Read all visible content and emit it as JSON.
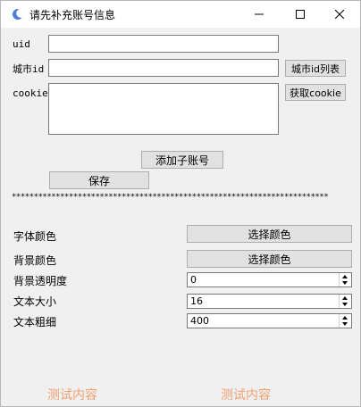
{
  "window": {
    "title": "请先补充账号信息"
  },
  "form": {
    "uid_label": "uid",
    "uid_value": "",
    "city_label": "城市id",
    "city_value": "",
    "city_list_button": "城市id列表",
    "cookie_label": "cookie",
    "cookie_value": "",
    "get_cookie_button": "获取cookie",
    "add_sub_account_button": "添加子账号",
    "save_button": "保存"
  },
  "separator": "************************************************************************",
  "settings": {
    "font_color_label": "字体颜色",
    "font_color_button": "选择颜色",
    "bg_color_label": "背景颜色",
    "bg_color_button": "选择颜色",
    "bg_opacity_label": "背景透明度",
    "bg_opacity_value": "0",
    "text_size_label": "文本大小",
    "text_size_value": "16",
    "text_weight_label": "文本粗细",
    "text_weight_value": "400"
  },
  "preview": {
    "left_text": "测试内容",
    "right_text": "测试内容",
    "color": "#f0a070"
  },
  "icons": {
    "app": "app-logo-icon",
    "minimize": "minimize-icon",
    "maximize": "maximize-icon",
    "close": "close-icon"
  }
}
